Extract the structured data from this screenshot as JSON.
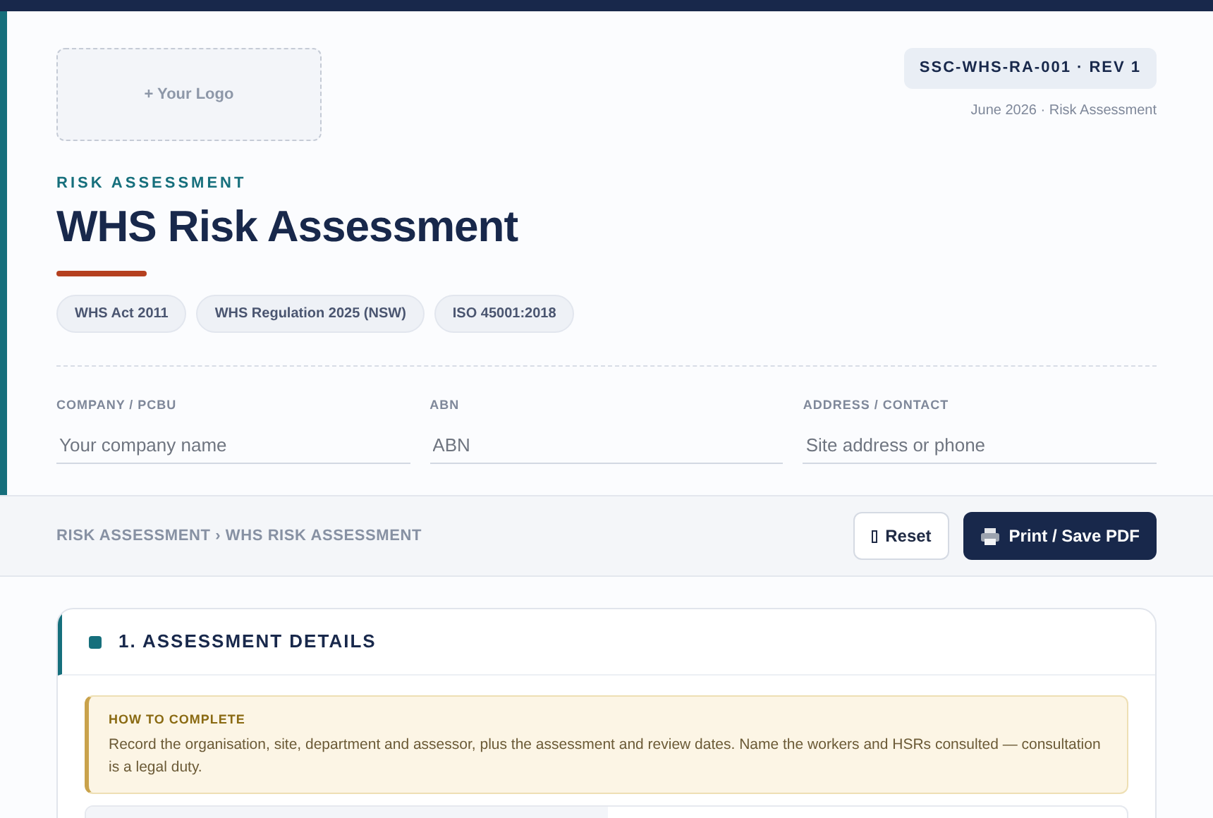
{
  "logo": {
    "label": "+ Your Logo"
  },
  "doc_ref": "SSC-WHS-RA-001 · REV 1",
  "doc_meta": "June 2026 · Risk Assessment",
  "eyebrow": "RISK ASSESSMENT",
  "title": "WHS Risk Assessment",
  "tags": [
    "WHS Act 2011",
    "WHS Regulation 2025 (NSW)",
    "ISO 45001:2018"
  ],
  "fields": [
    {
      "label": "COMPANY / PCBU",
      "placeholder": "Your company name"
    },
    {
      "label": "ABN",
      "placeholder": "ABN"
    },
    {
      "label": "ADDRESS / CONTACT",
      "placeholder": "Site address or phone"
    }
  ],
  "breadcrumb": "RISK ASSESSMENT › WHS RISK ASSESSMENT",
  "buttons": [
    {
      "kind": "secondary",
      "label": "Reset"
    },
    {
      "kind": "primary",
      "label": "Print / Save PDF"
    }
  ],
  "section": {
    "title": "1. ASSESSMENT DETAILS",
    "callout": {
      "title": "HOW TO COMPLETE",
      "text": "Record the organisation, site, department and assessor, plus the assessment and review dates. Name the workers and HSRs consulted — consultation is a legal duty."
    }
  }
}
